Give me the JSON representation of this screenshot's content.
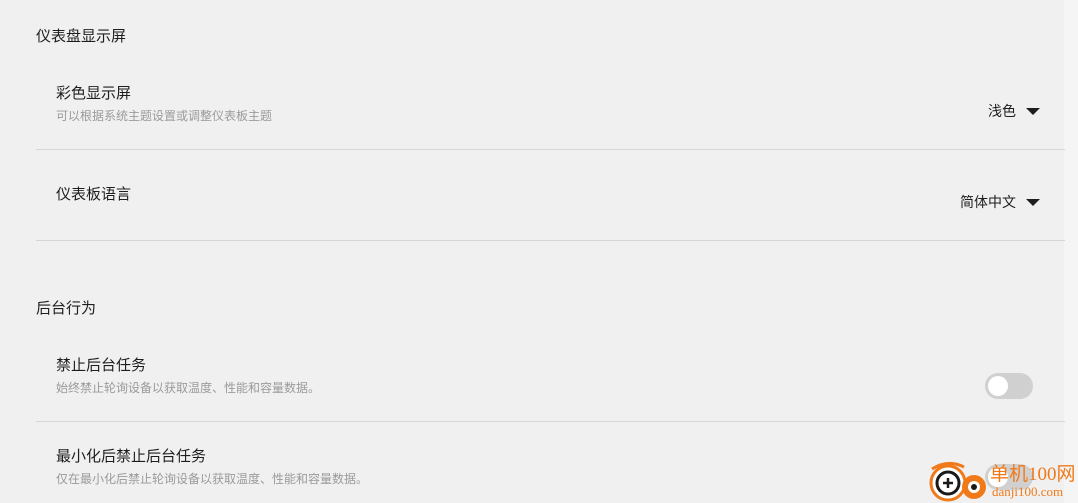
{
  "sections": {
    "dashboard": {
      "title": "仪表盘显示屏",
      "rows": [
        {
          "title": "彩色显示屏",
          "description": "可以根据系统主题设置或调整仪表板主题",
          "value": "浅色"
        },
        {
          "title": "仪表板语言",
          "value": "简体中文"
        }
      ]
    },
    "background": {
      "title": "后台行为",
      "rows": [
        {
          "title": "禁止后台任务",
          "description": "始终禁止轮询设备以获取温度、性能和容量数据。",
          "enabled": false
        },
        {
          "title": "最小化后禁止后台任务",
          "description": "仅在最小化后禁止轮询设备以获取温度、性能和容量数据。",
          "enabled": false
        }
      ]
    }
  },
  "watermark": {
    "line1": "单机100网",
    "line2": "danji100.com"
  },
  "colors": {
    "background": "#f0f0f0",
    "divider": "#d6d6d6",
    "toggle_off": "#d0d0d0",
    "watermark": "#f07a1a"
  }
}
